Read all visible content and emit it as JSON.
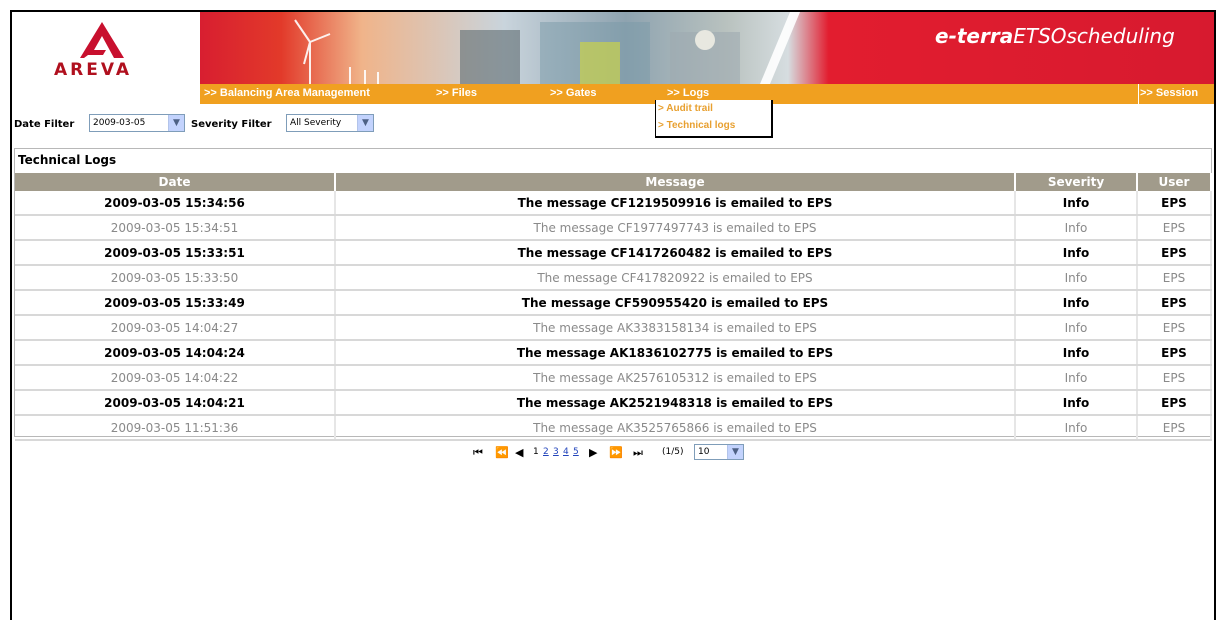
{
  "brand": {
    "logo_text": "AREVA",
    "app_title_bold": "e-terra",
    "app_title_rest": "ETSOscheduling"
  },
  "nav": {
    "items": [
      {
        "label": ">> Balancing Area Management"
      },
      {
        "label": ">> Files"
      },
      {
        "label": ">> Gates"
      },
      {
        "label": ">> Logs"
      },
      {
        "label": ">> Session"
      }
    ],
    "logs_menu": [
      {
        "label": "> Audit trail"
      },
      {
        "label": "> Technical logs"
      }
    ]
  },
  "filters": {
    "date_label": "Date Filter",
    "date_value": "2009-03-05",
    "severity_label": "Severity Filter",
    "severity_value": "All Severity"
  },
  "panel_title": "Technical Logs",
  "table": {
    "columns": [
      "Date",
      "Message",
      "Severity",
      "User"
    ],
    "rows": [
      {
        "date": "2009-03-05 15:34:56",
        "message": "The message CF1219509916 is emailed to EPS",
        "severity": "Info",
        "user": "EPS"
      },
      {
        "date": "2009-03-05 15:34:51",
        "message": "The message CF1977497743 is emailed to EPS",
        "severity": "Info",
        "user": "EPS"
      },
      {
        "date": "2009-03-05 15:33:51",
        "message": "The message CF1417260482 is emailed to EPS",
        "severity": "Info",
        "user": "EPS"
      },
      {
        "date": "2009-03-05 15:33:50",
        "message": "The message CF417820922 is emailed to EPS",
        "severity": "Info",
        "user": "EPS"
      },
      {
        "date": "2009-03-05 15:33:49",
        "message": "The message CF590955420 is emailed to EPS",
        "severity": "Info",
        "user": "EPS"
      },
      {
        "date": "2009-03-05 14:04:27",
        "message": "The message AK3383158134 is emailed to EPS",
        "severity": "Info",
        "user": "EPS"
      },
      {
        "date": "2009-03-05 14:04:24",
        "message": "The message AK1836102775 is emailed to EPS",
        "severity": "Info",
        "user": "EPS"
      },
      {
        "date": "2009-03-05 14:04:22",
        "message": "The message AK2576105312 is emailed to EPS",
        "severity": "Info",
        "user": "EPS"
      },
      {
        "date": "2009-03-05 14:04:21",
        "message": "The message AK2521948318 is emailed to EPS",
        "severity": "Info",
        "user": "EPS"
      },
      {
        "date": "2009-03-05 11:51:36",
        "message": "The message AK3525765866 is emailed to EPS",
        "severity": "Info",
        "user": "EPS"
      }
    ]
  },
  "pager": {
    "current_page": "1",
    "pages": [
      "2",
      "3",
      "4",
      "5"
    ],
    "count": "(1/5)",
    "page_size": "10"
  },
  "colors": {
    "brand_red": "#d71a2f",
    "nav_orange": "#f0a020",
    "header_gray": "#a19b8b",
    "menu_text": "#e8a030"
  }
}
